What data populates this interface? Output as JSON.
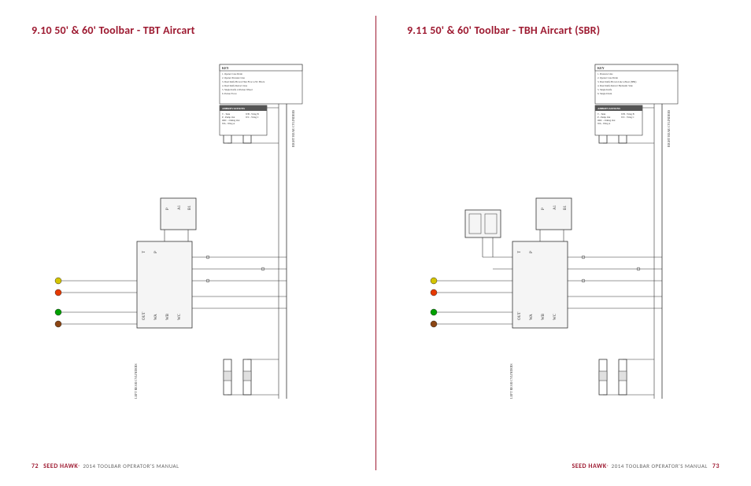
{
  "left": {
    "heading": "9.10 50' & 60' Toolbar - TBT Aircart",
    "pageNumber": "72",
    "brand": "SEED HAWK",
    "reg": "®",
    "footerText": "2014 TOOLBAR OPERATOR'S MANUAL",
    "keyTitle": "KEY",
    "keyItems": [
      "1. Opener Case Drain",
      "2. Opener Pressure Line",
      "3. Dual Knife Brown Thru Flow w/SC Block",
      "4. Dual Knife Retract Line",
      "5. Single Knife w/Packer Wheel",
      "6. Packer Force"
    ],
    "abbrTitle": "ABBREVIATIONS",
    "abbrItems": [
      "T - Tank",
      "P - Pump Out",
      "ORC - Orking Out",
      "WA - Wing A",
      "WB - Wing B",
      "WC - Wing C"
    ],
    "labels": {
      "leftCyl": "LEFT REAR CYLINDERS",
      "rightCyl": "RIGHT REAR CYLINDERS",
      "ports": [
        "T",
        "P",
        "OUT",
        "WA",
        "WB",
        "WC",
        "P",
        "A1",
        "B1"
      ]
    }
  },
  "right": {
    "heading": "9.11 50' & 60' Toolbar - TBH Aircart (SBR)",
    "pageNumber": "73",
    "brand": "SEED HAWK",
    "reg": "®",
    "footerText": "2014 TOOLBAR OPERATOR'S MANUAL",
    "keyTitle": "KEY",
    "keyItems": [
      "1. Pressure Line",
      "2. Opener Case Drain",
      "3. Dual Knife Brown Line w/Rear (SBR)",
      "4. Dual Knife Retract Hydraulic Side",
      "5. Single Knife",
      "6. Single Drain"
    ],
    "abbrTitle": "ABBREVIATIONS",
    "abbrItems": [
      "T - Tank",
      "P - Pump Out",
      "ORC - Orking Out",
      "WA - Wing A",
      "WB - Wing B",
      "WC - Wing C"
    ],
    "labels": {
      "leftCyl": "LEFT REAR CYLINDERS",
      "rightCyl": "RIGHT REAR CYLINDERS",
      "ports": [
        "T",
        "P",
        "OUT",
        "WA",
        "WB",
        "WC",
        "P",
        "A1",
        "B1"
      ]
    }
  }
}
